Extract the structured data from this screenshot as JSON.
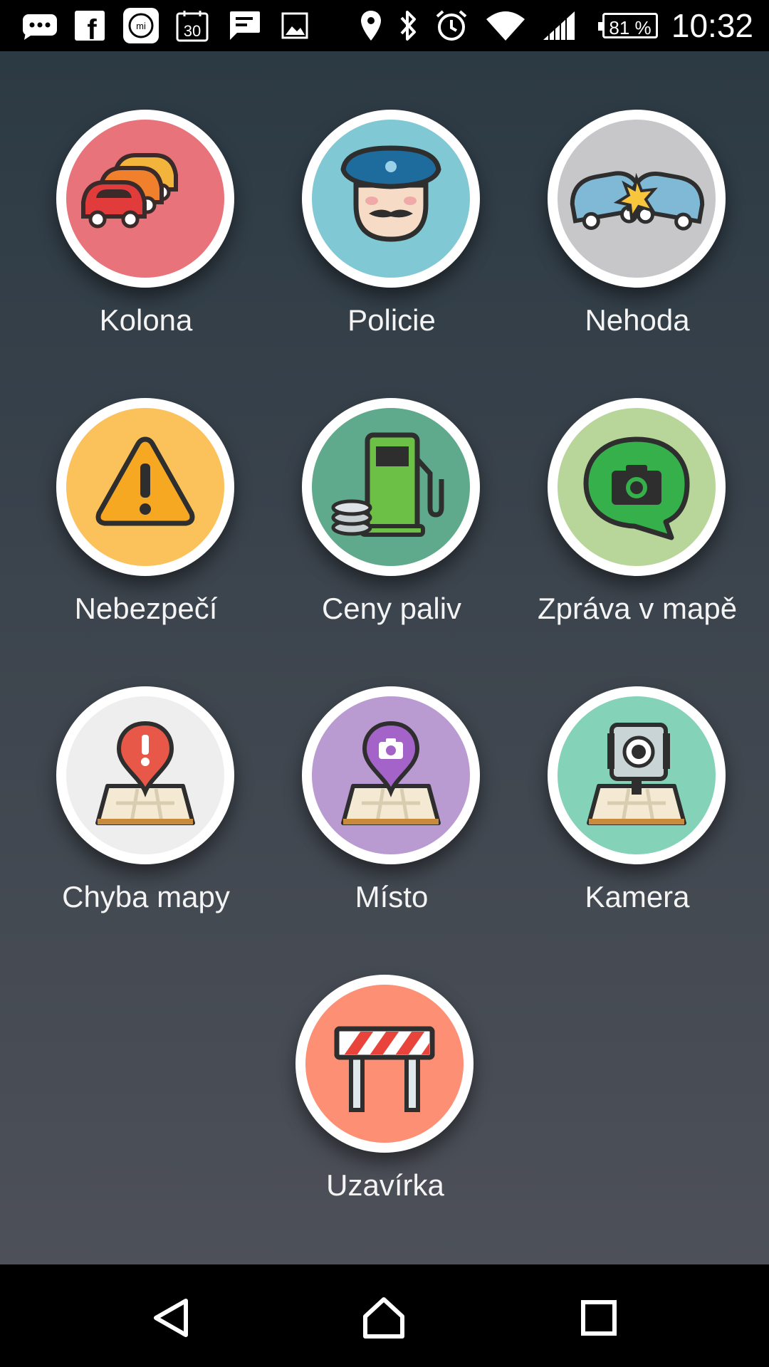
{
  "status_bar": {
    "time": "10:32",
    "battery_level": "81 %",
    "left_icons": [
      "chat-bubble-icon",
      "facebook-icon",
      "mi-fit-icon",
      "calendar-icon",
      "message-icon",
      "image-icon"
    ],
    "right_icons": [
      "location-icon",
      "bluetooth-icon",
      "alarm-icon",
      "wifi-icon",
      "signal-icon",
      "battery-icon"
    ],
    "calendar_day": "30",
    "facebook_letter": "f",
    "mi_letter": "mi"
  },
  "report_menu": {
    "items": [
      {
        "label": "Kolona",
        "icon": "traffic-jam-icon",
        "color": "#e8737b"
      },
      {
        "label": "Policie",
        "icon": "police-icon",
        "color": "#80c9d4"
      },
      {
        "label": "Nehoda",
        "icon": "accident-icon",
        "color": "#c7c7c9"
      },
      {
        "label": "Nebezpečí",
        "icon": "hazard-icon",
        "color": "#fbc15b"
      },
      {
        "label": "Ceny paliv",
        "icon": "fuel-price-icon",
        "color": "#5fa98c"
      },
      {
        "label": "Zpráva v mapě",
        "icon": "map-chat-icon",
        "color": "#b9d69a"
      },
      {
        "label": "Chyba mapy",
        "icon": "map-error-icon",
        "color": "#eeeeee"
      },
      {
        "label": "Místo",
        "icon": "place-icon",
        "color": "#b99ad1"
      },
      {
        "label": "Kamera",
        "icon": "speed-camera-icon",
        "color": "#84d2b8"
      },
      {
        "label": "Uzavírka",
        "icon": "road-closure-icon",
        "color": "#fd8f74"
      }
    ]
  },
  "navigation": {
    "icons": [
      "back-icon",
      "home-icon",
      "recent-apps-icon"
    ]
  }
}
